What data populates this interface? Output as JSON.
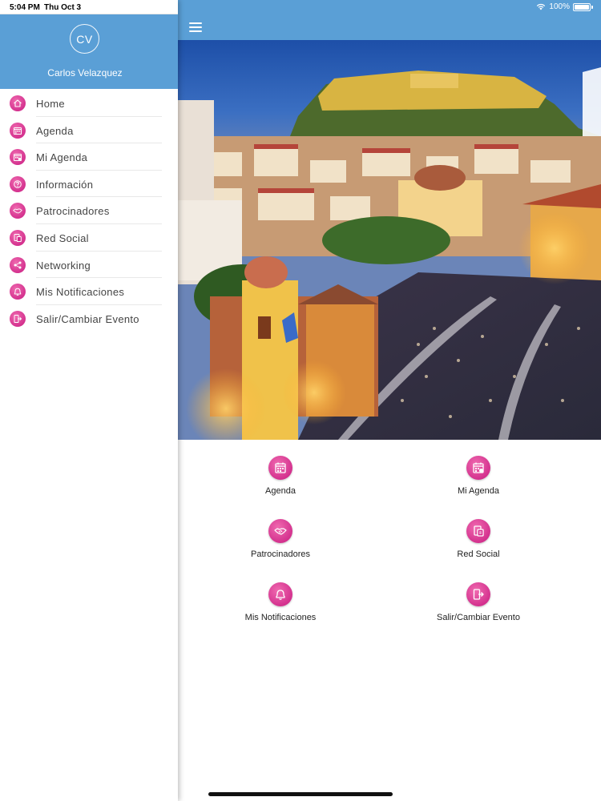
{
  "status": {
    "time": "5:04 PM",
    "date": "Thu Oct 3",
    "battery": "100%"
  },
  "drawer": {
    "avatar_initials": "CV",
    "username": "Carlos Velazquez",
    "items": [
      {
        "label": "Home",
        "icon": "home-icon"
      },
      {
        "label": "Agenda",
        "icon": "calendar-icon"
      },
      {
        "label": "Mi Agenda",
        "icon": "calendar-user-icon"
      },
      {
        "label": "Información",
        "icon": "question-icon"
      },
      {
        "label": "Patrocinadores",
        "icon": "handshake-icon"
      },
      {
        "label": "Red Social",
        "icon": "social-icon"
      },
      {
        "label": "Networking",
        "icon": "share-icon"
      },
      {
        "label": "Mis Notificaciones",
        "icon": "bell-icon"
      },
      {
        "label": "Salir/Cambiar Evento",
        "icon": "exit-icon"
      }
    ]
  },
  "banner": {
    "slides": 5,
    "active_slide": 1
  },
  "grid": {
    "tiles": [
      {
        "label": "Agenda",
        "icon": "calendar-icon"
      },
      {
        "label": "Mi Agenda",
        "icon": "calendar-user-icon"
      },
      {
        "label": "Patrocinadores",
        "icon": "handshake-icon"
      },
      {
        "label": "Red Social",
        "icon": "social-icon"
      },
      {
        "label": "Mis Notificaciones",
        "icon": "bell-icon"
      },
      {
        "label": "Salir/Cambiar Evento",
        "icon": "exit-icon"
      }
    ]
  },
  "colors": {
    "header_blue": "#5a9fd6",
    "accent_pink": "#d62b8c"
  }
}
